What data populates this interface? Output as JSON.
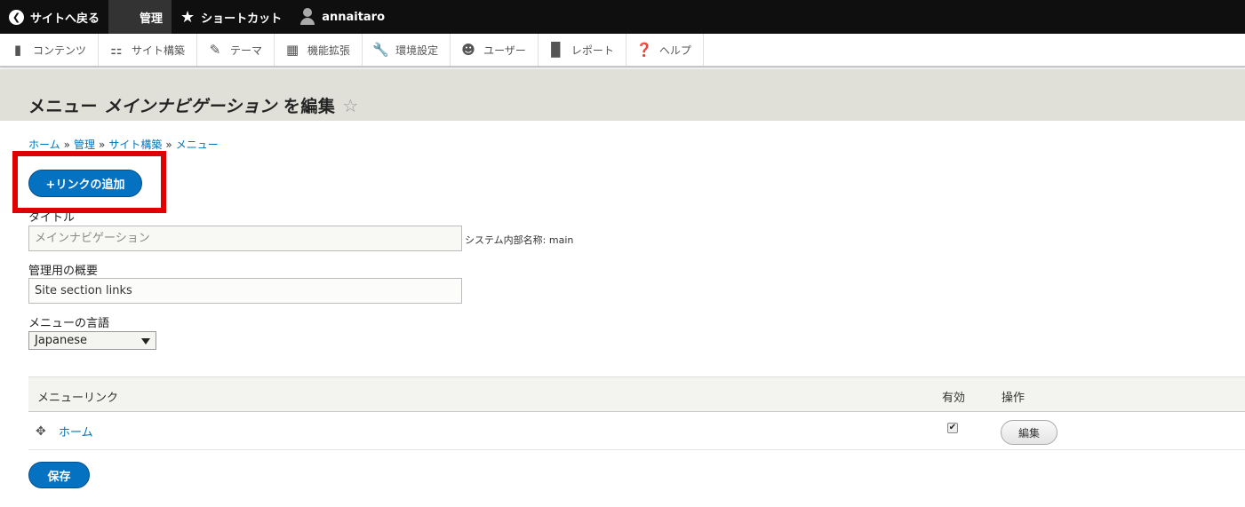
{
  "toolbar": {
    "back": "サイトへ戻る",
    "manage": "管理",
    "shortcuts": "ショートカット",
    "user": "annaitaro"
  },
  "tray": [
    {
      "label": "コンテンツ",
      "icon": "page-icon"
    },
    {
      "label": "サイト構築",
      "icon": "sitemap-icon"
    },
    {
      "label": "テーマ",
      "icon": "brush-icon"
    },
    {
      "label": "機能拡張",
      "icon": "puzzle-icon"
    },
    {
      "label": "環境設定",
      "icon": "wrench-icon"
    },
    {
      "label": "ユーザー",
      "icon": "people-icon"
    },
    {
      "label": "レポート",
      "icon": "bar-chart-icon"
    },
    {
      "label": "ヘルプ",
      "icon": "help-icon"
    }
  ],
  "page": {
    "title_prefix": "メニュー ",
    "title_em": "メインナビゲーション",
    "title_suffix": " を編集",
    "fav_star": "☆"
  },
  "breadcrumb": {
    "items": [
      "ホーム",
      "管理",
      "サイト構築",
      "メニュー"
    ],
    "separator": "»"
  },
  "add_link_button": "+リンクの追加",
  "form": {
    "title_label": "タイトル",
    "title_value": "メインナビゲーション",
    "machine_name": "システム内部名称: main",
    "desc_label": "管理用の概要",
    "desc_value": "Site section links",
    "lang_label": "メニューの言語",
    "lang_value": "Japanese"
  },
  "table": {
    "headers": {
      "link": "メニューリンク",
      "enabled": "有効",
      "ops": "操作"
    },
    "rows": [
      {
        "link": "ホーム",
        "enabled": true,
        "op": "編集"
      }
    ]
  },
  "save_button": "保存",
  "colors": {
    "accent": "#0471c1",
    "highlight": "#e00000",
    "toolbar": "#0f0f0f"
  }
}
